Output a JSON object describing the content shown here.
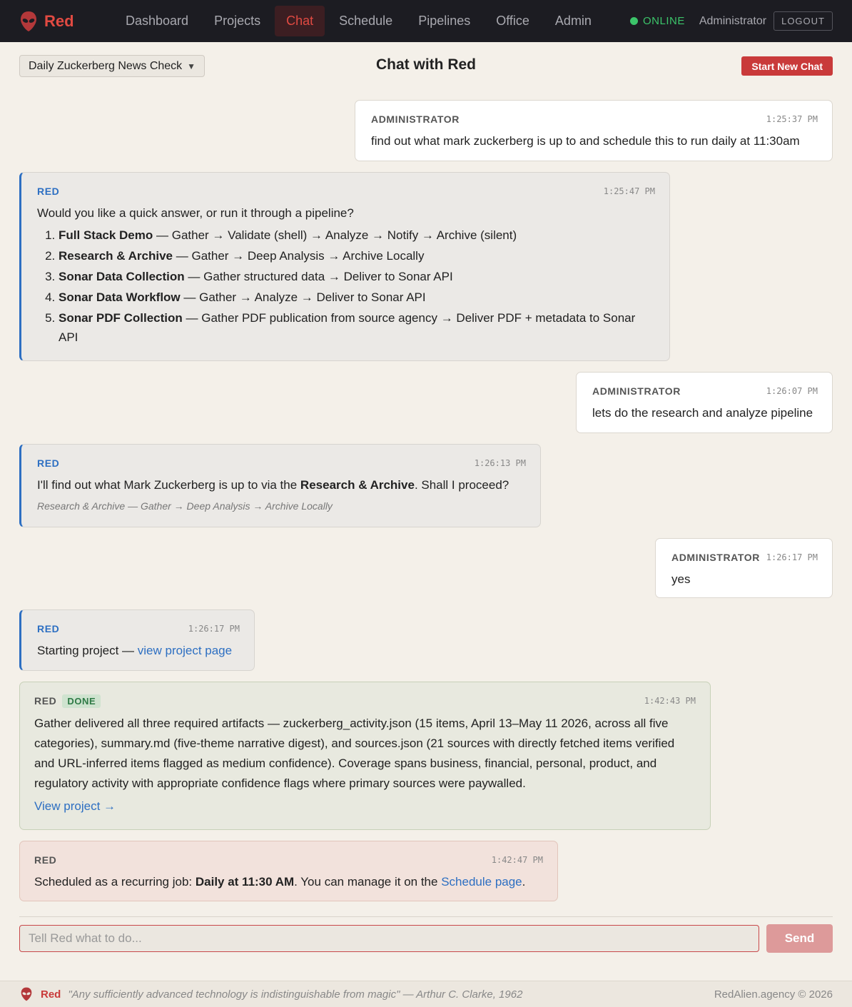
{
  "app": {
    "name": "Red"
  },
  "nav": {
    "items": [
      {
        "label": "Dashboard",
        "active": false
      },
      {
        "label": "Projects",
        "active": false
      },
      {
        "label": "Chat",
        "active": true
      },
      {
        "label": "Schedule",
        "active": false
      },
      {
        "label": "Pipelines",
        "active": false
      },
      {
        "label": "Office",
        "active": false
      },
      {
        "label": "Admin",
        "active": false
      }
    ],
    "status": "ONLINE",
    "user": "Administrator",
    "logout": "LOGOUT"
  },
  "header": {
    "chat_select": "Daily Zuckerberg News Check",
    "title": "Chat with Red",
    "new_chat": "Start New Chat"
  },
  "messages": [
    {
      "sender": "ADMINISTRATOR",
      "time": "1:25:37 PM",
      "text": "find out what mark zuckerberg is up to and schedule this to run daily at 11:30am"
    },
    {
      "sender": "RED",
      "time": "1:25:47 PM",
      "intro": "Would you like a quick answer, or run it through a pipeline?",
      "options": [
        {
          "name": "Full Stack Demo",
          "desc": "— Gather → Validate (shell) → Analyze → Notify → Archive (silent)"
        },
        {
          "name": "Research & Archive",
          "desc": "— Gather → Deep Analysis → Archive Locally"
        },
        {
          "name": "Sonar Data Collection",
          "desc": "— Gather structured data → Deliver to Sonar API"
        },
        {
          "name": "Sonar Data Workflow",
          "desc": "— Gather → Analyze → Deliver to Sonar API"
        },
        {
          "name": "Sonar PDF Collection",
          "desc": "— Gather PDF publication from source agency → Deliver PDF + metadata to Sonar API"
        }
      ]
    },
    {
      "sender": "ADMINISTRATOR",
      "time": "1:26:07 PM",
      "text": "lets do the research and analyze pipeline"
    },
    {
      "sender": "RED",
      "time": "1:26:13 PM",
      "text_before": "I'll find out what Mark Zuckerberg is up to via the ",
      "text_bold": "Research & Archive",
      "text_after": ". Shall I proceed?",
      "sub": "Research & Archive — Gather → Deep Analysis → Archive Locally"
    },
    {
      "sender": "ADMINISTRATOR",
      "time": "1:26:17 PM",
      "text": "yes"
    },
    {
      "sender": "RED",
      "time": "1:26:17 PM",
      "text": "Starting project — ",
      "link": "view project page"
    },
    {
      "sender": "RED",
      "badge": "DONE",
      "time": "1:42:43 PM",
      "text": "Gather delivered all three required artifacts — zuckerberg_activity.json (15 items, April 13–May 11 2026, across all five categories), summary.md (five-theme narrative digest), and sources.json (21 sources with directly fetched items verified and URL-inferred items flagged as medium confidence). Coverage spans business, financial, personal, product, and regulatory activity with appropriate confidence flags where primary sources were paywalled.",
      "link": "View project →"
    },
    {
      "sender": "RED",
      "time": "1:42:47 PM",
      "text_before": "Scheduled as a recurring job: ",
      "text_bold": "Daily at 11:30 AM",
      "text_mid": ". You can manage it on the ",
      "link": "Schedule page",
      "text_after": "."
    }
  ],
  "composer": {
    "placeholder": "Tell Red what to do...",
    "send": "Send"
  },
  "footer": {
    "brand": "Red",
    "quote": "\"Any sufficiently advanced technology is indistinguishable from magic\" — Arthur C. Clarke, 1962",
    "copyright": "RedAlien.agency © 2026"
  },
  "colors": {
    "brand": "#e14a42",
    "accent": "#2d6fc2",
    "online": "#3cc46a",
    "nav_bg": "#1c1c22"
  }
}
